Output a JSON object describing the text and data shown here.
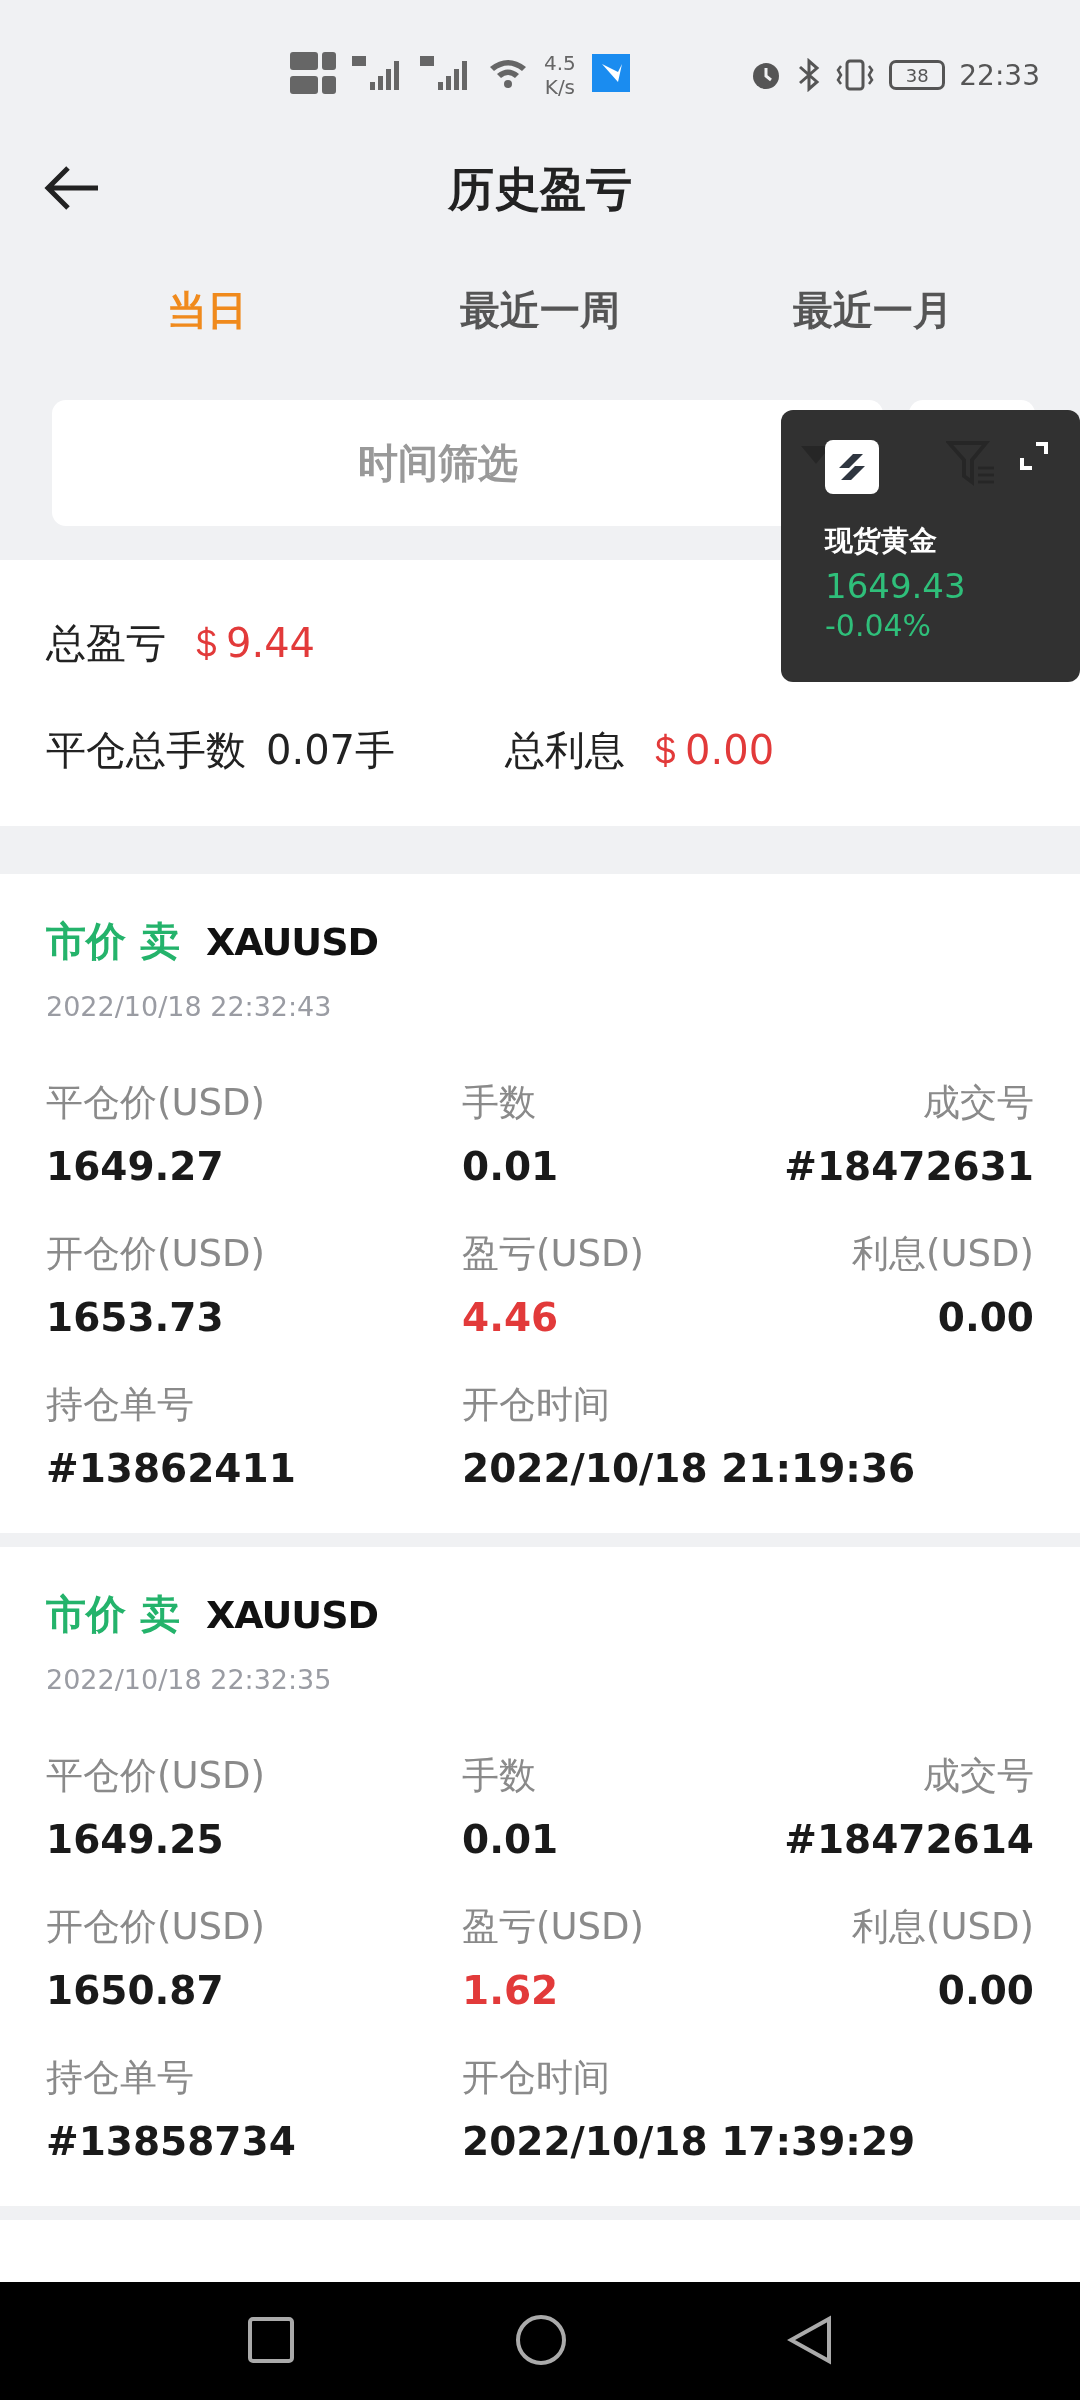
{
  "status_bar": {
    "speed_value": "4.5",
    "speed_unit": "K/s",
    "battery": "38",
    "time": "22:33"
  },
  "header": {
    "title": "历史盈亏"
  },
  "tabs": [
    {
      "label": "当日",
      "selected": true
    },
    {
      "label": "最近一周",
      "selected": false
    },
    {
      "label": "最近一月",
      "selected": false
    }
  ],
  "filter": {
    "placeholder": "时间筛选"
  },
  "summary": {
    "total_pnl_label": "总盈亏",
    "total_pnl": "＄9.44",
    "lots_label": "平仓总手数",
    "lots": "0.07手",
    "interest_label": "总利息",
    "interest": "＄0.00"
  },
  "trades": [
    {
      "side": "市价 卖",
      "symbol": "XAUUSD",
      "time": "2022/10/18 22:32:43",
      "fields": [
        {
          "label": "平仓价(USD)",
          "value": "1649.27",
          "kind": "plain"
        },
        {
          "label": "手数",
          "value": "0.01",
          "kind": "plain"
        },
        {
          "label": "成交号",
          "value": "#18472631",
          "kind": "plain"
        },
        {
          "label": "开仓价(USD)",
          "value": "1653.73",
          "kind": "plain"
        },
        {
          "label": "盈亏(USD)",
          "value": "4.46",
          "kind": "pnl"
        },
        {
          "label": "利息(USD)",
          "value": "0.00",
          "kind": "plain"
        },
        {
          "label": "持仓单号",
          "value": "#13862411",
          "kind": "plain"
        },
        {
          "label": "开仓时间",
          "value": "2022/10/18 21:19:36",
          "kind": "plain"
        }
      ]
    },
    {
      "side": "市价 卖",
      "symbol": "XAUUSD",
      "time": "2022/10/18 22:32:35",
      "fields": [
        {
          "label": "平仓价(USD)",
          "value": "1649.25",
          "kind": "plain"
        },
        {
          "label": "手数",
          "value": "0.01",
          "kind": "plain"
        },
        {
          "label": "成交号",
          "value": "#18472614",
          "kind": "plain"
        },
        {
          "label": "开仓价(USD)",
          "value": "1650.87",
          "kind": "plain"
        },
        {
          "label": "盈亏(USD)",
          "value": "1.62",
          "kind": "pnl"
        },
        {
          "label": "利息(USD)",
          "value": "0.00",
          "kind": "plain"
        },
        {
          "label": "持仓单号",
          "value": "#13858734",
          "kind": "plain"
        },
        {
          "label": "开仓时间",
          "value": "2022/10/18 17:39:29",
          "kind": "plain"
        }
      ]
    }
  ],
  "float_quote": {
    "name": "现货黄金",
    "price": "1649.43",
    "change": "-0.04%"
  }
}
